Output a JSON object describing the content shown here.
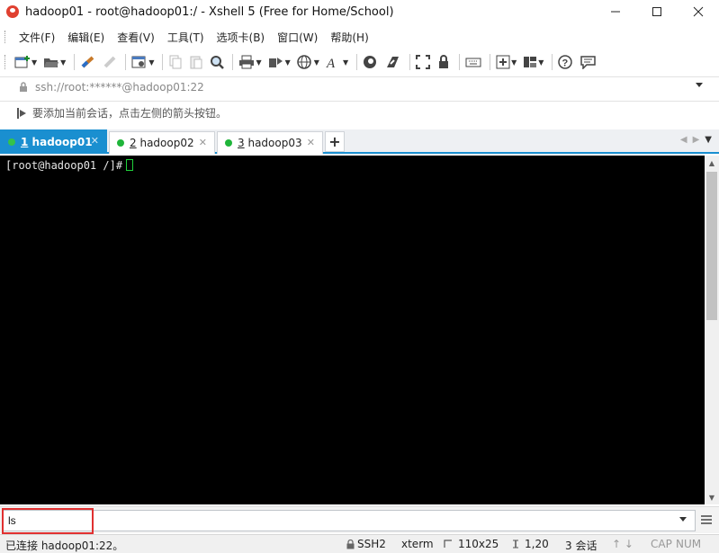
{
  "window": {
    "title": "hadoop01 - root@hadoop01:/ - Xshell 5 (Free for Home/School)",
    "icon": "xshell-app-icon",
    "controls": [
      "minimize-icon",
      "maximize-icon",
      "close-icon"
    ]
  },
  "menu": {
    "items": [
      "文件(F)",
      "编辑(E)",
      "查看(V)",
      "工具(T)",
      "选项卡(B)",
      "窗口(W)",
      "帮助(H)"
    ]
  },
  "toolbar": {
    "icons": [
      "new-session-icon",
      "open-folder-icon",
      "reconnect-icon",
      "disconnect-icon",
      "properties-icon",
      "copy-icon",
      "paste-icon",
      "find-icon",
      "print-icon",
      "transfer-icon",
      "globe-icon",
      "font-icon",
      "xftp-icon",
      "xmanager-icon",
      "fullscreen-icon",
      "lock-icon",
      "keyboard-icon",
      "compose-icon",
      "layout-icon",
      "help-icon",
      "chat-icon"
    ]
  },
  "address": {
    "text": "ssh://root:******@hadoop01:22"
  },
  "hint": {
    "text": "要添加当前会话，点击左侧的箭头按钮。"
  },
  "tabs": [
    {
      "index": "1",
      "label": "hadoop01",
      "active": true
    },
    {
      "index": "2",
      "label": "hadoop02",
      "active": false
    },
    {
      "index": "3",
      "label": "hadoop03",
      "active": false
    }
  ],
  "terminal": {
    "prompt": "[root@hadoop01 /]#"
  },
  "compose": {
    "value": "ls"
  },
  "status": {
    "connection": "已连接 hadoop01:22。",
    "protocol": "SSH2",
    "term_type": "xterm",
    "size": "110x25",
    "cursor_pos": "1,20",
    "sessions": "3 会话",
    "cap": "CAP",
    "num": "NUM"
  },
  "colors": {
    "tab_active": "#1a8fd0",
    "terminal_bg": "#000000",
    "cursor": "#1fd03a",
    "highlight": "#e03030"
  }
}
